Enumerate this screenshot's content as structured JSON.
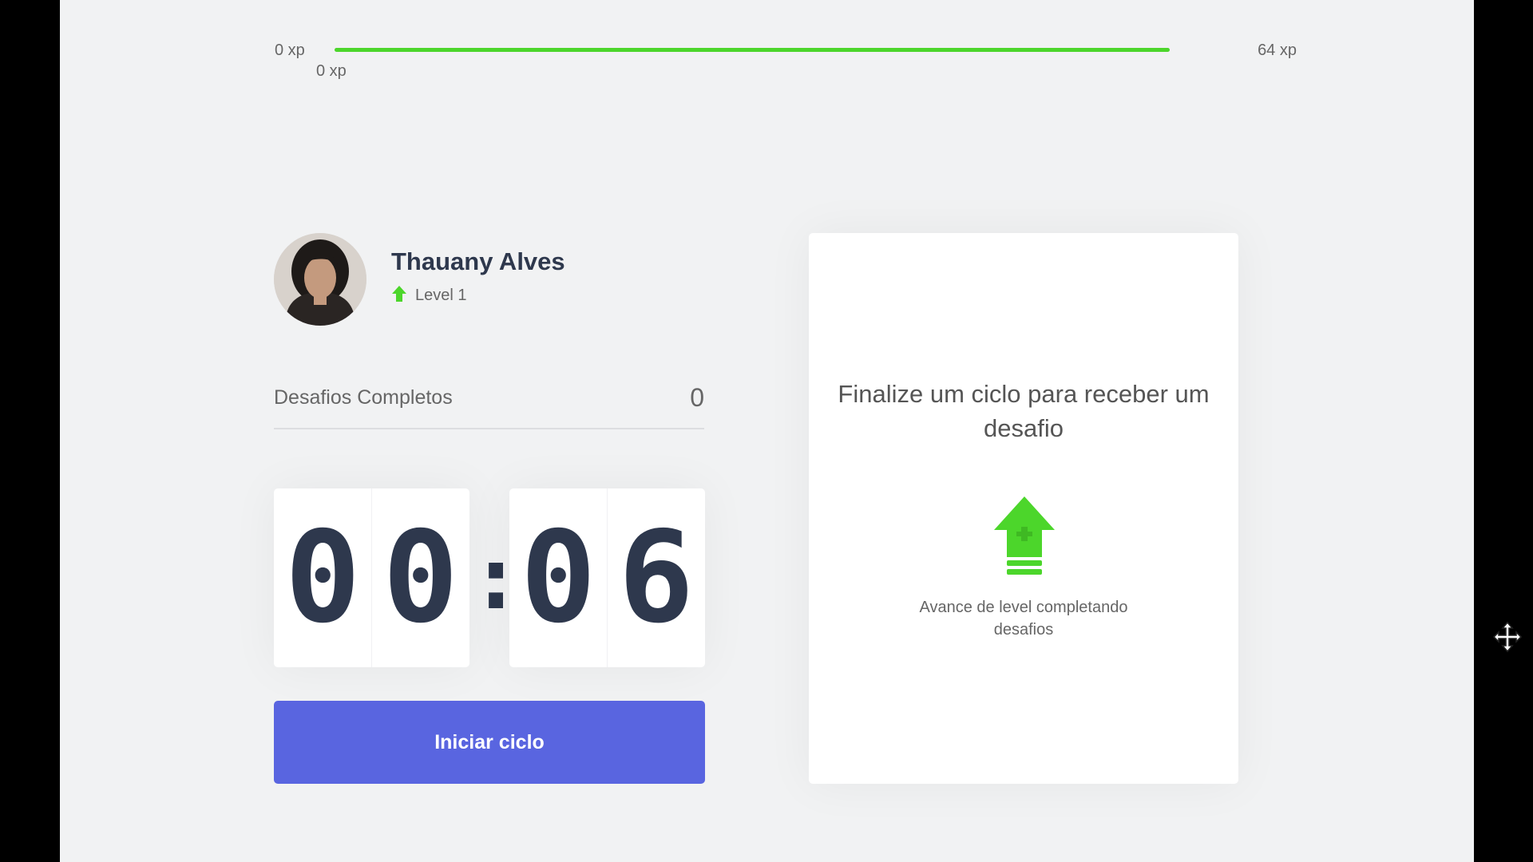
{
  "xp": {
    "start_label": "0 xp",
    "end_label": "64 xp",
    "current_label": "0 xp",
    "progress_fraction": 1.0,
    "fill_color": "#4cd62b"
  },
  "profile": {
    "name": "Thauany Alves",
    "level_label": "Level 1",
    "avatar": "profile-photo",
    "level_icon": "level-up-arrow-icon"
  },
  "completed": {
    "label": "Desafios Completos",
    "count": "0"
  },
  "countdown": {
    "minutes": [
      "0",
      "0"
    ],
    "separator": ":",
    "seconds": [
      "0",
      "6"
    ]
  },
  "start_button": {
    "label": "Iniciar ciclo",
    "color": "#5965e0"
  },
  "challenge": {
    "title": "Finalize um ciclo para receber um desafio",
    "hint": "Avance de level completando desafios",
    "icon": "level-up-icon"
  },
  "cursor": {
    "icon": "move-cursor-icon"
  }
}
